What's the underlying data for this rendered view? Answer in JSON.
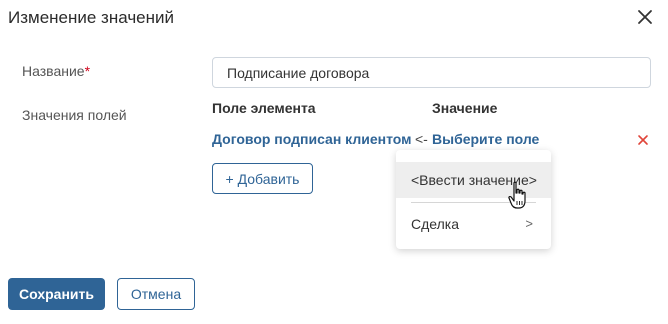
{
  "dialog": {
    "title": "Изменение значений",
    "close_icon": "close-icon"
  },
  "form": {
    "name_label": "Название",
    "required_mark": "*",
    "name_value": "Подписание договора",
    "fields_label": "Значения полей",
    "column_element": "Поле элемента",
    "column_value": "Значение",
    "row": {
      "element": "Договор подписан клиентом",
      "arrow": "<-",
      "value_link": "Выберите поле",
      "remove_icon": "remove-icon"
    },
    "add_button": "+ Добавить"
  },
  "dropdown": {
    "items": [
      {
        "label": "<Ввести значение>"
      },
      {
        "label": "Сделка",
        "chevron": ">"
      }
    ]
  },
  "footer": {
    "save": "Сохранить",
    "cancel": "Отмена"
  },
  "colors": {
    "accent": "#2f6496",
    "required": "#d0021b",
    "remove": "#e0453a"
  }
}
